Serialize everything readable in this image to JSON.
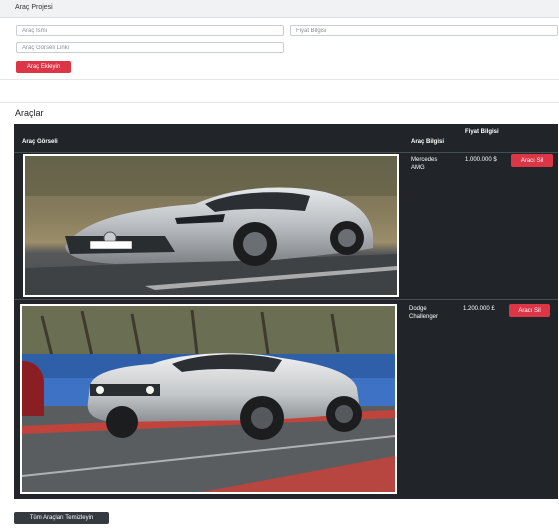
{
  "header": {
    "title": "Araç Projesi"
  },
  "form": {
    "name_placeholder": "Araç İsmi",
    "price_placeholder": "Fiyat Bilgisi",
    "image_placeholder": "Araç Görseli Linki",
    "add_button": "Araç Ekleyin"
  },
  "list": {
    "title": "Araçlar",
    "columns": {
      "image": "Araç Görseli",
      "info": "Araç Bilgisi",
      "price": "Fiyat Bilgisi"
    },
    "rows": [
      {
        "name": "Mercedes AMG",
        "price": "1.000.000 $",
        "delete": "Aracı Sil"
      },
      {
        "name": "Dodge Challenger",
        "price": "1.200.000 £",
        "delete": "Aracı Sil"
      }
    ]
  },
  "clear_button": "Tüm Araçları Temizleyin",
  "colors": {
    "danger": "#dc3545",
    "table_bg": "#212529",
    "dark_button": "#343a40"
  }
}
